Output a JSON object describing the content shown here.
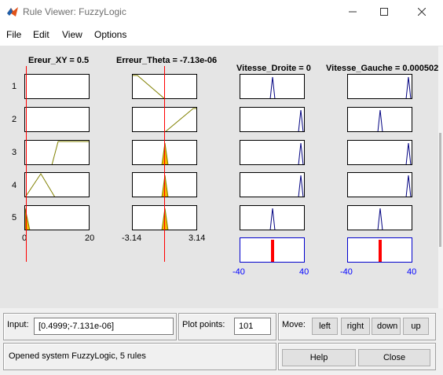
{
  "window": {
    "title": "Rule Viewer: FuzzyLogic"
  },
  "menu": [
    "File",
    "Edit",
    "View",
    "Options"
  ],
  "inputs": [
    {
      "name": "Ereur_XY = 0.5",
      "range": [
        "0",
        "20"
      ]
    },
    {
      "name": "Erreur_Theta = -7.13e-06",
      "range": [
        "-3.14",
        "3.14"
      ]
    }
  ],
  "outputs": [
    {
      "name": "Vitesse_Droite = 0",
      "range": [
        "-40",
        "40"
      ]
    },
    {
      "name": "Vitesse_Gauche = 0.000502",
      "range": [
        "-40",
        "40"
      ]
    }
  ],
  "rules": [
    "1",
    "2",
    "3",
    "4",
    "5"
  ],
  "controls": {
    "input_label": "Input:",
    "input_value": "[0.4999;-7.131e-06]",
    "plot_points_label": "Plot points:",
    "plot_points_value": "101",
    "move_label": "Move:",
    "move_buttons": [
      "left",
      "right",
      "down",
      "up"
    ],
    "help_label": "Help",
    "close_label": "Close",
    "status": "Opened system FuzzyLogic, 5 rules"
  },
  "colors": {
    "mf_line": "#808000",
    "fill": "#f5b800",
    "output_line": "#000080",
    "aggregate_bar": "#ff0000",
    "indicator_line": "#ff0000"
  }
}
